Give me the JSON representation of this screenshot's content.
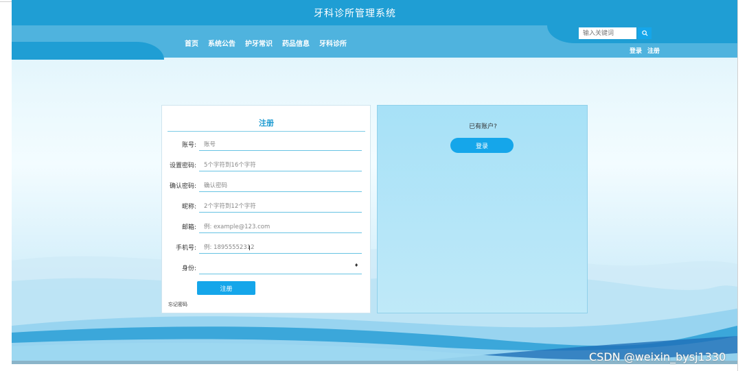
{
  "header": {
    "site_title": "牙科诊所管理系统",
    "nav": [
      "首页",
      "系统公告",
      "护牙常识",
      "药品信息",
      "牙科诊所"
    ],
    "search_placeholder": "输入关键词",
    "auth": {
      "login": "登录",
      "register": "注册"
    }
  },
  "register_form": {
    "title": "注册",
    "fields": [
      {
        "label": "账号:",
        "placeholder": "账号"
      },
      {
        "label": "设置密码:",
        "placeholder": "5个字符到16个字符"
      },
      {
        "label": "确认密码:",
        "placeholder": "确认密码"
      },
      {
        "label": "昵称:",
        "placeholder": "2个字符到12个字符"
      },
      {
        "label": "邮箱:",
        "placeholder": "例: example@123.com"
      },
      {
        "label": "手机号:",
        "placeholder": "例: 18955552312"
      },
      {
        "label": "身份:",
        "placeholder": ""
      }
    ],
    "submit": "注册",
    "forgot": "忘记密码"
  },
  "login_panel": {
    "prompt": "已有账户?",
    "button": "登录"
  },
  "watermark": "CSDN @weixin_bysj1330",
  "colors": {
    "primary": "#1f9ed4",
    "button": "#15a6ea",
    "nav_band": "#4fb3de"
  }
}
